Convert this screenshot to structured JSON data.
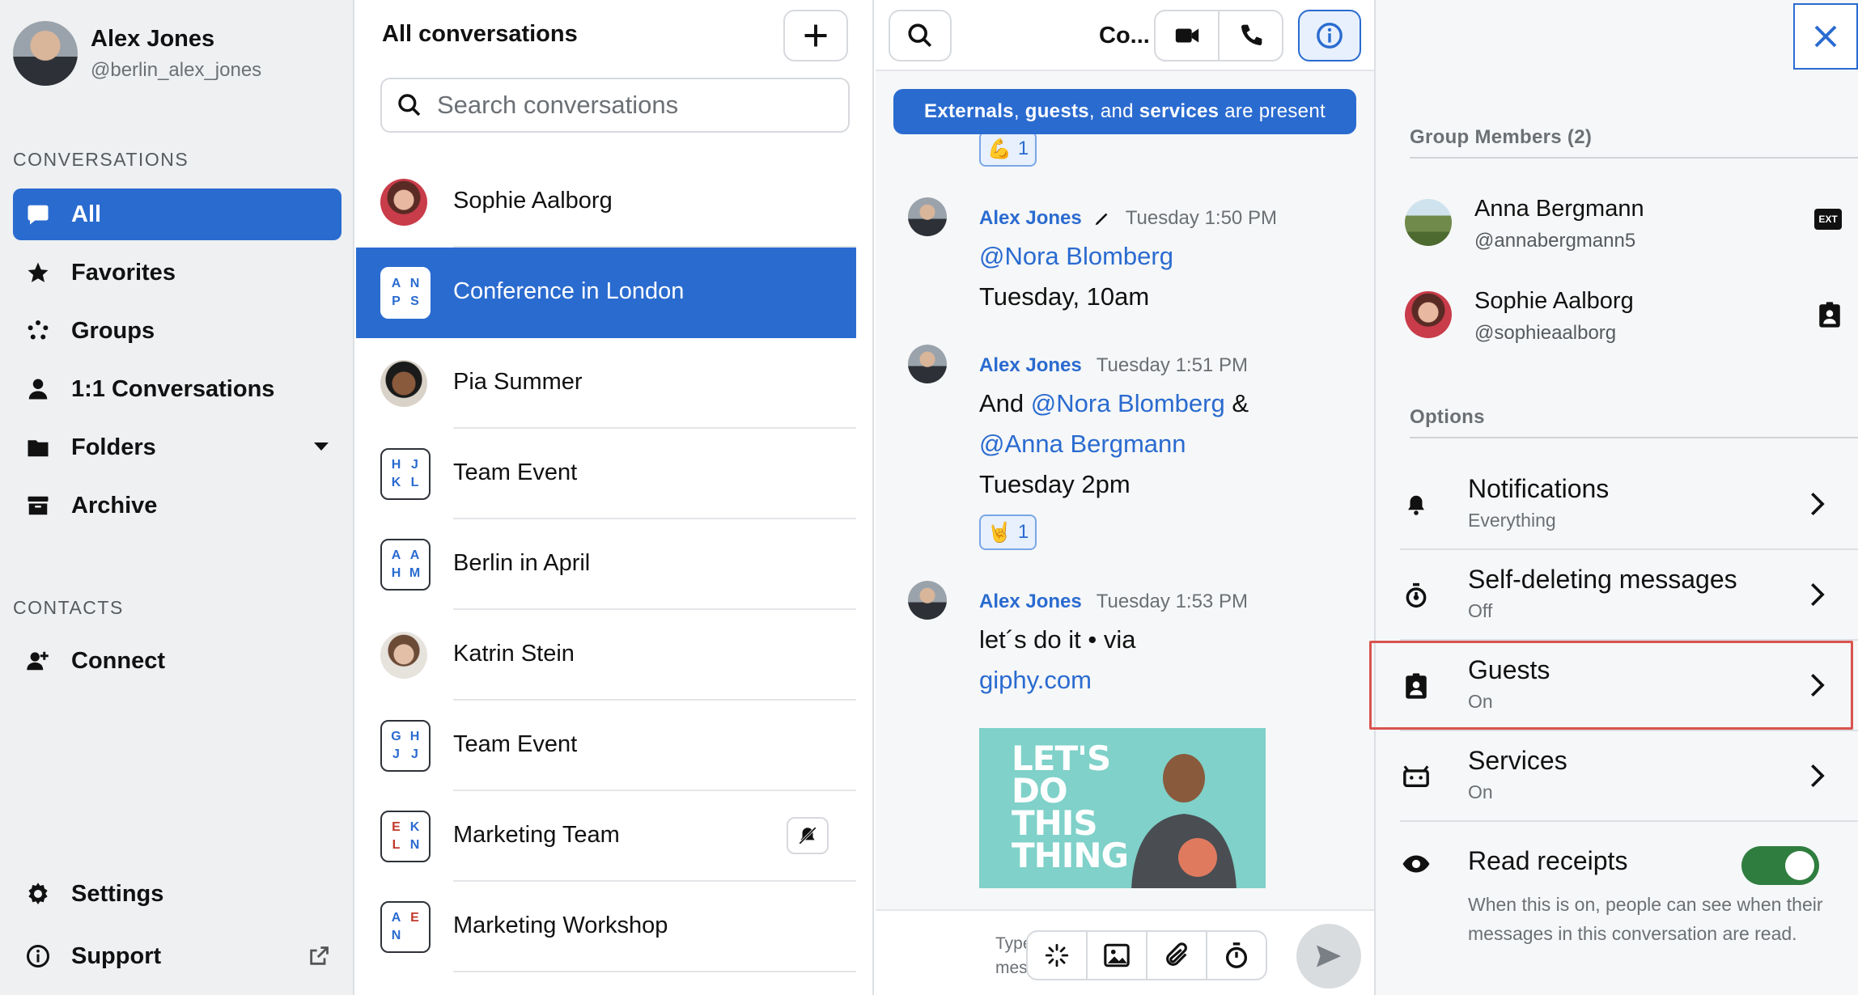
{
  "profile": {
    "name": "Alex Jones",
    "handle": "@berlin_alex_jones"
  },
  "sidebar": {
    "conversations_title": "CONVERSATIONS",
    "items": [
      {
        "label": "All",
        "icon": "chat-bubble-icon",
        "active": true
      },
      {
        "label": "Favorites",
        "icon": "star-icon"
      },
      {
        "label": "Groups",
        "icon": "groups-icon"
      },
      {
        "label": "1:1 Conversations",
        "icon": "person-icon"
      },
      {
        "label": "Folders",
        "icon": "folder-icon"
      },
      {
        "label": "Archive",
        "icon": "archive-icon"
      }
    ],
    "contacts_title": "CONTACTS",
    "connect_label": "Connect",
    "settings_label": "Settings",
    "support_label": "Support"
  },
  "conversations": {
    "title": "All conversations",
    "search_placeholder": "Search conversations",
    "rows": [
      {
        "name": "Sophie Aalborg",
        "type": "person"
      },
      {
        "name": "Conference in London",
        "type": "group",
        "letters": [
          "A",
          "N",
          "P",
          "S"
        ],
        "active": true
      },
      {
        "name": "Pia Summer",
        "type": "person"
      },
      {
        "name": "Team Event",
        "type": "group",
        "letters": [
          "H",
          "J",
          "K",
          "L"
        ]
      },
      {
        "name": "Berlin in April",
        "type": "group",
        "letters": [
          "A",
          "A",
          "H",
          "M"
        ]
      },
      {
        "name": "Katrin Stein",
        "type": "person"
      },
      {
        "name": "Team Event",
        "type": "group",
        "letters": [
          "G",
          "H",
          "J",
          "J"
        ]
      },
      {
        "name": "Marketing Team",
        "type": "group",
        "letters": [
          "E",
          "K",
          "L",
          "N"
        ],
        "muted": true
      },
      {
        "name": "Marketing Workshop",
        "type": "group",
        "letters": [
          "A",
          "E",
          "N",
          ""
        ]
      }
    ]
  },
  "chat": {
    "title": "Co...",
    "banner": {
      "w1": "Externals",
      "sep1": ", ",
      "w2": "guests",
      "sep2": ", and ",
      "w3": "services",
      "tail": " are present"
    },
    "top_reaction": {
      "emoji": "💪",
      "count": "1"
    },
    "messages": [
      {
        "author": "Alex Jones",
        "time": "Tuesday 1:50 PM",
        "edited": true,
        "mention1": "@Nora Blomberg",
        "line2": "Tuesday, 10am"
      },
      {
        "author": "Alex Jones",
        "time": "Tuesday 1:51 PM",
        "prefix": "And ",
        "mention1": "@Nora Blomberg",
        "amp": " &",
        "mention2": "@Anna Bergmann",
        "line3": "Tuesday 2pm",
        "reaction": {
          "emoji": "🤘",
          "count": "1"
        }
      },
      {
        "author": "Alex Jones",
        "time": "Tuesday 1:53 PM",
        "line1": "let´s do it • via",
        "link": "giphy.com"
      }
    ],
    "gif_text": [
      "LET'S",
      "DO",
      "THIS",
      "THING"
    ],
    "composer_placeholder": "Type a message"
  },
  "details": {
    "members_title": "Group Members (2)",
    "members": [
      {
        "name": "Anna Bergmann",
        "handle": "@annabergmann5",
        "badge": "EXT"
      },
      {
        "name": "Sophie Aalborg",
        "handle": "@sophieaalborg",
        "badge": "guest-badge-icon"
      }
    ],
    "options_title": "Options",
    "options": [
      {
        "label": "Notifications",
        "value": "Everything",
        "icon": "bell-icon"
      },
      {
        "label": "Self-deleting messages",
        "value": "Off",
        "icon": "timer-icon"
      },
      {
        "label": "Guests",
        "value": "On",
        "icon": "guest-icon",
        "highlighted": true
      },
      {
        "label": "Services",
        "value": "On",
        "icon": "robot-icon"
      }
    ],
    "read_receipts": {
      "label": "Read receipts",
      "enabled": true,
      "description": "When this is on, people can see when their messages in this conversation are read."
    }
  },
  "colors": {
    "accent": "#2a6bd0",
    "toggle_on": "#2f7d3f",
    "highlight": "#d9534f"
  }
}
